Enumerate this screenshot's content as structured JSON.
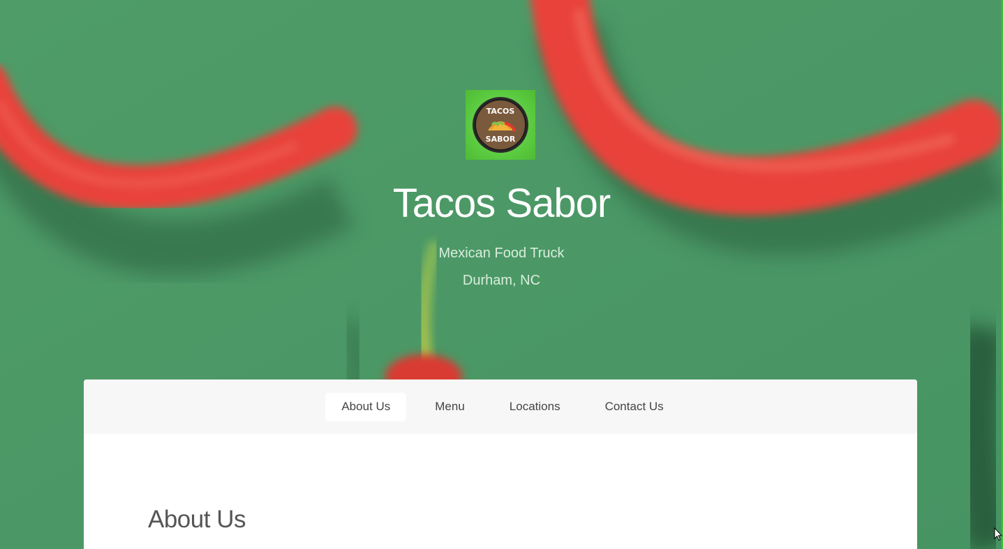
{
  "site": {
    "title": "Tacos Sabor",
    "tagline_line1": "Mexican Food Truck",
    "tagline_line2": "Durham, NC",
    "logo_text_top": "TACOS",
    "logo_text_bottom": "SABOR"
  },
  "nav": {
    "items": [
      {
        "label": "About Us",
        "active": true
      },
      {
        "label": "Menu",
        "active": false
      },
      {
        "label": "Locations",
        "active": false
      },
      {
        "label": "Contact Us",
        "active": false
      }
    ]
  },
  "main": {
    "heading": "About Us"
  },
  "colors": {
    "background_green": "#4b9966",
    "pepper_red": "#e8433a",
    "logo_green": "#58c83d",
    "panel_white": "#ffffff",
    "nav_gray": "#f7f7f7"
  },
  "icons": {
    "cursor": "mouse-pointer-icon"
  }
}
